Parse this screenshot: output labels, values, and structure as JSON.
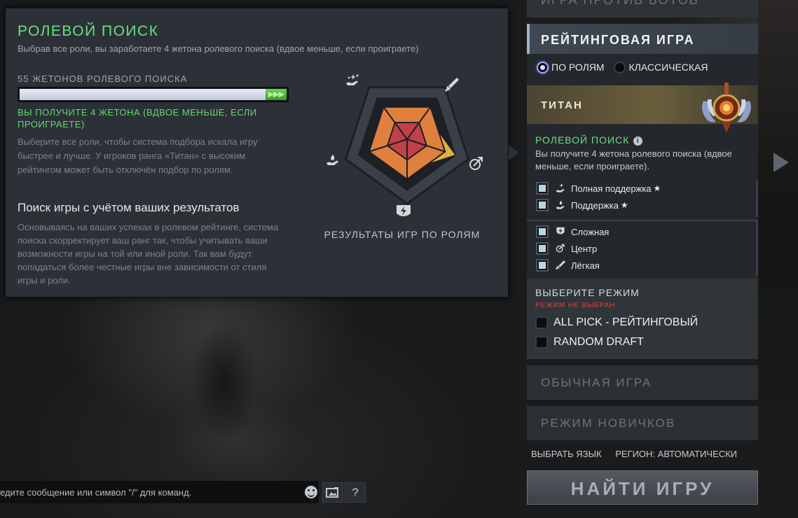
{
  "role_popup": {
    "title": "РОЛЕВОЙ ПОИСК",
    "subtitle": "Выбрав все роли, вы заработаете 4 жетона ролевого поиска (вдвое меньше, если проиграете)",
    "tokens_label": "55 ЖЕТОНОВ РОЛЕВОГО ПОИСКА",
    "token_gain_arrows": "▶▶▶",
    "token_fill_fraction": 1.0,
    "token_gain_fraction": 0.08,
    "reward_note": "ВЫ ПОЛУЧИТЕ 4 ЖЕТОНА (ВДВОЕ МЕНЬШЕ, ЕСЛИ ПРОИГРАЕТЕ)",
    "description": "Выберите все роли, чтобы система подбора искала игру быстрее и лучше. У игроков ранга «Титан» с высоким рейтингом может быть отключён подбор по ролям.",
    "section_title": "Поиск игры с учётом ваших результатов",
    "section_text": "Основываясь на ваших успехах в ролевом рейтинге, система поиска скорректирует ваш ранг так, чтобы учитывать ваши возможности игры на той или иной роли. Так вам будут попадаться более честные игры вне зависимости от стиля игры и роли.",
    "chart_caption": "РЕЗУЛЬТАТЫ ИГР ПО РОЛЯМ"
  },
  "chart_data": {
    "type": "radar",
    "categories": [
      "Лёгкая",
      "Центр",
      "Сложная",
      "Поддержка",
      "Полная поддержка"
    ],
    "series": [
      {
        "values": [
          1,
          2,
          1,
          1,
          1
        ],
        "color": "#e8a84a"
      },
      {
        "values": [
          1,
          1,
          1,
          1,
          1
        ],
        "color": "#e0724a"
      }
    ],
    "colors": {
      "ring_dark": "#1d2125",
      "ring_mid": "#3a4047",
      "orange": "#e0803f",
      "red": "#c2404a",
      "yellow": "#e2b040"
    }
  },
  "right_panel": {
    "top_tab": "ИГРА ПРОТИВ БОТОВ",
    "ranked_title": "РЕЙТИНГОВАЯ ИГРА",
    "radio_role": "ПО РОЛЯМ",
    "radio_classic": "КЛАССИЧЕСКАЯ",
    "rank_name": "ТИТАН",
    "role_search_title": "РОЛЕВОЙ ПОИСК",
    "role_search_desc": "Вы получите 4 жетона ролевого поиска (вдвое меньше, если проиграете).",
    "roles_support": [
      {
        "label": "Полная поддержка",
        "star": "★",
        "icon": "hard-support-icon"
      },
      {
        "label": "Поддержка",
        "star": "★",
        "icon": "soft-support-icon"
      }
    ],
    "roles_core": [
      {
        "label": "Сложная",
        "icon": "offlane-icon"
      },
      {
        "label": "Центр",
        "icon": "mid-icon"
      },
      {
        "label": "Лёгкая",
        "icon": "carry-icon"
      }
    ],
    "mode_title": "ВЫБЕРИТЕ РЕЖИМ",
    "mode_warning": "РЕЖИМ НЕ ВЫБРАН",
    "modes": [
      "ALL PICK - РЕЙТИНГОВЫЙ",
      "RANDOM DRAFT"
    ],
    "normal_game": "ОБЫЧНАЯ ИГРА",
    "newbie_mode": "РЕЖИМ НОВИЧКОВ",
    "choose_language": "ВЫБРАТЬ ЯЗЫК",
    "region": "РЕГИОН: АВТОМАТИЧЕСКИ",
    "find_game": "НАЙТИ ИГРУ"
  },
  "chat": {
    "placeholder": "едите сообщение или символ \"/\" для команд.",
    "help": "?"
  },
  "colors": {
    "accent_green": "#6ede83",
    "warn_red": "#e0423b",
    "panel_bg": "#2c3137"
  }
}
